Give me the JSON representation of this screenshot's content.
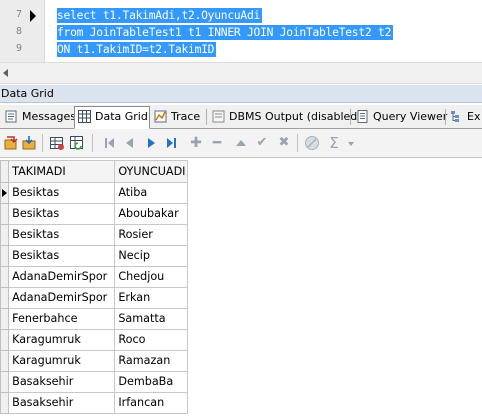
{
  "editor": {
    "line_numbers": [
      "7",
      "8",
      "9"
    ],
    "lines": [
      "select t1.TakimAdi,t2.OyuncuAdi",
      "from JoinTableTest1 t1 INNER JOIN JoinTableTest2 t2",
      "ON t1.TakimID=t2.TakimID"
    ],
    "selection_color": "#3399ff"
  },
  "panel": {
    "title": "Data Grid"
  },
  "tabs": [
    {
      "label": "Messages",
      "icon": "messages-icon"
    },
    {
      "label": "Data Grid",
      "icon": "data-grid-icon",
      "active": true
    },
    {
      "label": "Trace",
      "icon": "trace-icon"
    },
    {
      "label": "DBMS Output (disabled)",
      "icon": "dbms-output-icon"
    },
    {
      "label": "Query Viewer",
      "icon": "query-viewer-icon"
    },
    {
      "label": "Ex",
      "icon": "explain-icon"
    }
  ],
  "toolbar": {
    "icons": [
      "export-icon",
      "save-icon",
      "grid-options-icon",
      "refresh-icon",
      "first-record-icon",
      "previous-record-icon",
      "next-record-icon",
      "last-record-icon",
      "insert-record-icon",
      "delete-record-icon",
      "move-up-icon",
      "move-down-icon",
      "post-edit-icon",
      "cancel-edit-icon",
      "filter-icon",
      "sum-icon"
    ]
  },
  "grid": {
    "columns": [
      "TAKIMADI",
      "OYUNCUADI"
    ],
    "rows": [
      [
        "Besiktas",
        "Atiba"
      ],
      [
        "Besiktas",
        "Aboubakar"
      ],
      [
        "Besiktas",
        "Rosier"
      ],
      [
        "Besiktas",
        "Necip"
      ],
      [
        "AdanaDemirSpor",
        "Chedjou"
      ],
      [
        "AdanaDemirSpor",
        "Erkan"
      ],
      [
        "Fenerbahce",
        "Samatta"
      ],
      [
        "Karagumruk",
        "Roco"
      ],
      [
        "Karagumruk",
        "Ramazan"
      ],
      [
        "Basaksehir",
        "DembaBa"
      ],
      [
        "Basaksehir",
        "Irfancan"
      ]
    ],
    "current_row": 0
  }
}
